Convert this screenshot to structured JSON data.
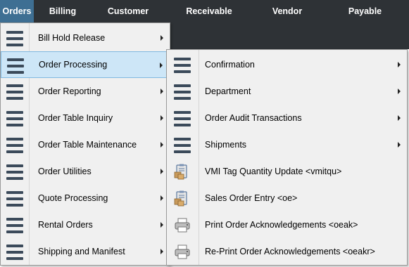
{
  "menubar": {
    "items": [
      {
        "label": "Orders"
      },
      {
        "label": "Billing"
      },
      {
        "label": "Customer"
      },
      {
        "label": "Receivable"
      },
      {
        "label": "Vendor"
      },
      {
        "label": "Payable"
      }
    ],
    "active_index": 0,
    "active_color": "#3e6f93",
    "bar_color": "#2e3236"
  },
  "orders_menu": {
    "items": [
      {
        "label": "Bill Hold Release",
        "icon": "hamburger-icon",
        "submenu": true
      },
      {
        "label": "Order Processing",
        "icon": "hamburger-icon",
        "submenu": true,
        "highlighted": true
      },
      {
        "label": "Order Reporting",
        "icon": "hamburger-icon",
        "submenu": true
      },
      {
        "label": "Order Table Inquiry",
        "icon": "hamburger-icon",
        "submenu": true
      },
      {
        "label": "Order Table Maintenance",
        "icon": "hamburger-icon",
        "submenu": true
      },
      {
        "label": "Order Utilities",
        "icon": "hamburger-icon",
        "submenu": true
      },
      {
        "label": "Quote Processing",
        "icon": "hamburger-icon",
        "submenu": true
      },
      {
        "label": "Rental Orders",
        "icon": "hamburger-icon",
        "submenu": true
      },
      {
        "label": "Shipping and Manifest",
        "icon": "hamburger-icon",
        "submenu": true
      }
    ]
  },
  "order_processing_menu": {
    "items": [
      {
        "label": "Confirmation",
        "icon": "hamburger-icon",
        "submenu": true
      },
      {
        "label": "Department",
        "icon": "hamburger-icon",
        "submenu": true
      },
      {
        "label": "Order Audit Transactions",
        "icon": "hamburger-icon",
        "submenu": true
      },
      {
        "label": "Shipments",
        "icon": "hamburger-icon",
        "submenu": true
      },
      {
        "label": "VMI Tag Quantity Update <vmitqu>",
        "icon": "clipboard-boxes-icon",
        "submenu": false
      },
      {
        "label": "Sales Order Entry <oe>",
        "icon": "clipboard-boxes-icon",
        "submenu": false
      },
      {
        "label": "Print Order Acknowledgements <oeak>",
        "icon": "printer-icon",
        "submenu": false
      },
      {
        "label": "Re-Print Order Acknowledgements <oeakr>",
        "icon": "printer-icon",
        "submenu": false
      }
    ]
  }
}
